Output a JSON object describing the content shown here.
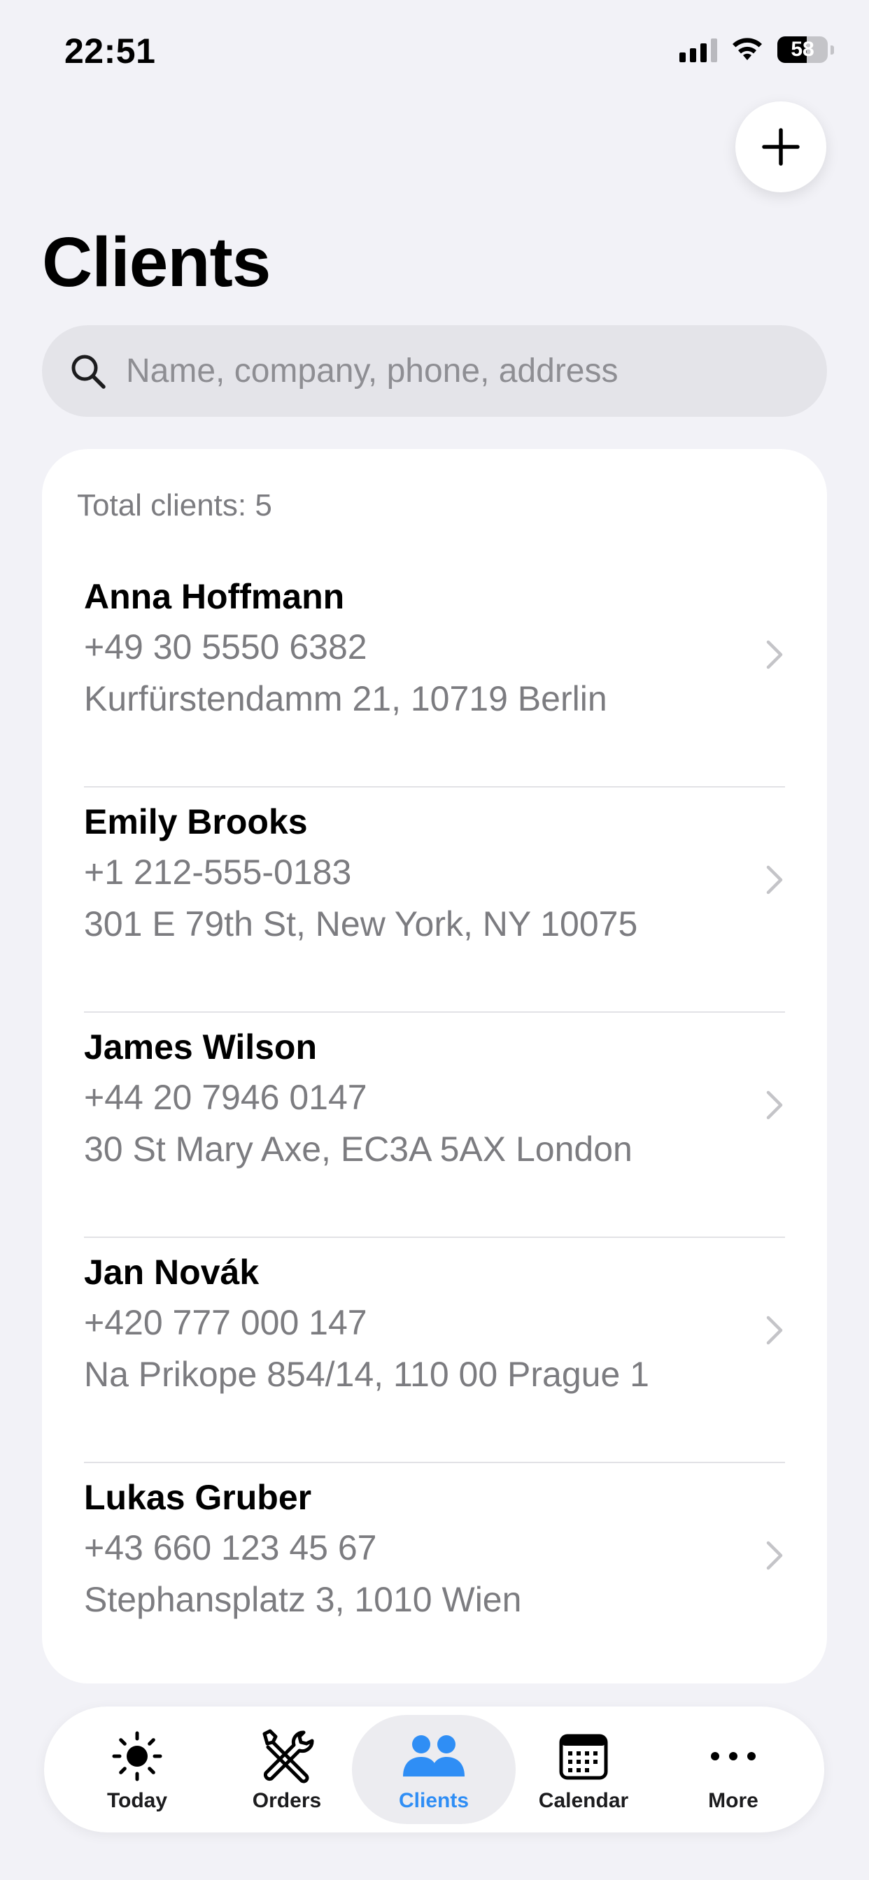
{
  "status_bar": {
    "time": "22:51",
    "battery": "58",
    "battery_level": 0.58
  },
  "header": {
    "title": "Clients"
  },
  "search": {
    "placeholder": "Name, company, phone, address"
  },
  "list": {
    "total_label": "Total clients: 5",
    "clients": [
      {
        "name": "Anna Hoffmann",
        "phone": "+49 30 5550 6382",
        "address": "Kurfürstendamm 21, 10719 Berlin"
      },
      {
        "name": "Emily Brooks",
        "phone": "+1 212-555-0183",
        "address": "301 E 79th St, New York, NY 10075"
      },
      {
        "name": "James Wilson",
        "phone": "+44 20 7946 0147",
        "address": "30 St Mary Axe, EC3A 5AX London"
      },
      {
        "name": "Jan Novák",
        "phone": "+420 777 000 147",
        "address": "Na Prikope 854/14, 110 00 Prague 1"
      },
      {
        "name": "Lukas Gruber",
        "phone": "+43 660 123 45 67",
        "address": "Stephansplatz 3, 1010 Wien"
      }
    ]
  },
  "tabbar": {
    "tabs": [
      {
        "label": "Today",
        "icon": "sun-icon"
      },
      {
        "label": "Orders",
        "icon": "tools-icon"
      },
      {
        "label": "Clients",
        "icon": "people-icon",
        "active": true
      },
      {
        "label": "Calendar",
        "icon": "calendar-icon"
      },
      {
        "label": "More",
        "icon": "ellipsis-icon"
      }
    ],
    "active_color": "#2f8ef5"
  }
}
